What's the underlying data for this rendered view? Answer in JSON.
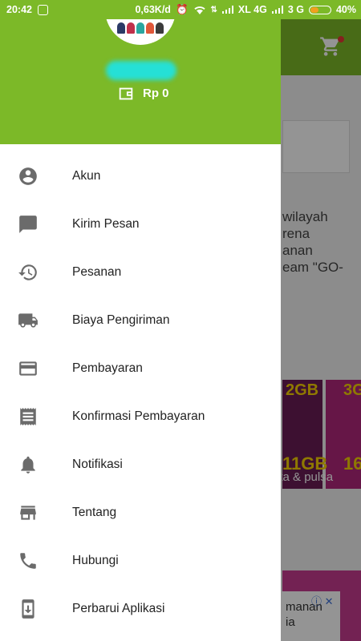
{
  "status_bar": {
    "time": "20:42",
    "speed": "0,63K/d",
    "carrier1": "XL 4G",
    "carrier2": "3 G",
    "battery": "40%",
    "battery_level": 0.4
  },
  "drawer": {
    "balance": "Rp 0",
    "items": [
      {
        "label": "Akun",
        "icon": "account-circle-icon"
      },
      {
        "label": "Kirim Pesan",
        "icon": "message-icon"
      },
      {
        "label": "Pesanan",
        "icon": "history-icon"
      },
      {
        "label": "Biaya Pengiriman",
        "icon": "truck-icon"
      },
      {
        "label": "Pembayaran",
        "icon": "credit-card-icon"
      },
      {
        "label": "Konfirmasi Pembayaran",
        "icon": "receipt-icon"
      },
      {
        "label": "Notifikasi",
        "icon": "bell-icon"
      },
      {
        "label": "Tentang",
        "icon": "store-icon"
      },
      {
        "label": "Hubungi",
        "icon": "phone-icon"
      },
      {
        "label": "Perbarui Aplikasi",
        "icon": "app-update-icon"
      }
    ]
  },
  "background": {
    "text": "wilayah\nrena\nanan\neam \"GO-",
    "banner_a": "2GB",
    "banner_b": "3G",
    "banner_c": "11GB",
    "banner_d": "16",
    "banner_caption": "ota & pulsa",
    "ad_text": "manan\nia"
  },
  "colors": {
    "primary": "#7cb928",
    "icon_gray": "#6b6b6b"
  }
}
